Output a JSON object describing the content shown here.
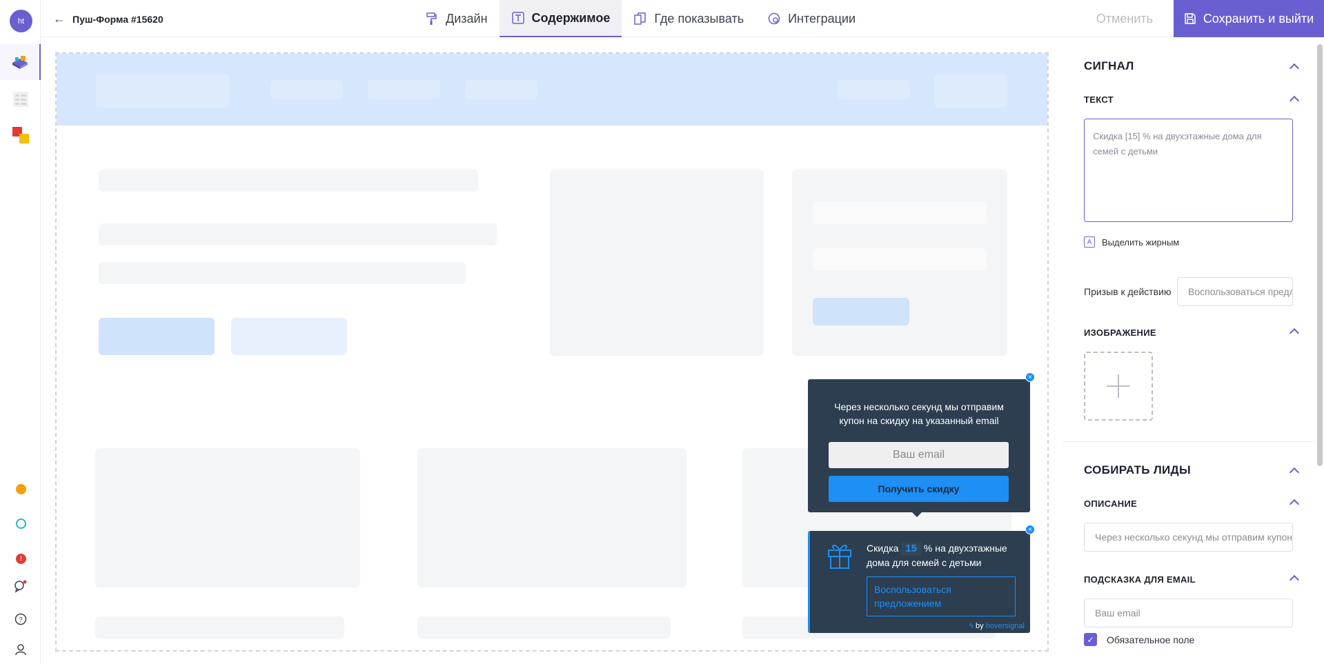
{
  "user": {
    "avatar_initials": "ht"
  },
  "header": {
    "back_arrow": "←",
    "title": "Пуш-Форма #15620",
    "tabs": [
      {
        "label": "Дизайн",
        "icon": "paint-roller-icon"
      },
      {
        "label": "Содержимое",
        "icon": "text-icon"
      },
      {
        "label": "Где показывать",
        "icon": "pages-icon"
      },
      {
        "label": "Интеграции",
        "icon": "integration-icon"
      }
    ],
    "active_tab": "Содержимое",
    "cancel_label": "Отменить",
    "save_label": "Сохранить и выйти"
  },
  "rail": {
    "icons": [
      "widgets-icon",
      "list-icon",
      "apps-icon"
    ],
    "status_dots": [
      {
        "color": "#f5a00d"
      },
      {
        "color": "#21b8c9"
      },
      {
        "color": "#e53935"
      }
    ],
    "bottom_icons": [
      "chat-icon",
      "help-icon",
      "profile-icon"
    ]
  },
  "preview": {
    "popup_form": {
      "message": "Через несколько секунд мы отправим купон на скидку на указанный email",
      "email_placeholder": "Ваш email",
      "button_label": "Получить скидку"
    },
    "signal": {
      "text_before": "Скидка",
      "number": "15",
      "text_after": "% на двухэтажные дома для семей с детьми",
      "cta_label": "Воспользоваться предложением",
      "by": "by",
      "brand": "hoversignal"
    },
    "close_glyph": "×"
  },
  "panel": {
    "signal_title": "СИГНАЛ",
    "text_section": "ТЕКСТ",
    "text_value": "Скидка [15] % на двухэтажные дома для семей с детьми",
    "bold_option": "Выделить жирным",
    "bold_icon_glyph": "A",
    "cta_label": "Призыв к действию",
    "cta_value": "Воспользоваться предложением",
    "image_section": "ИЗОБРАЖЕНИЕ",
    "leads_title": "СОБИРАТЬ ЛИДЫ",
    "description_section": "ОПИСАНИЕ",
    "description_value": "Через несколько секунд мы отправим купон на скидку на указанный email",
    "email_hint_section": "ПОДСКАЗКА ДЛЯ EMAIL",
    "email_hint_value": "Ваш email",
    "required_label": "Обязательное поле",
    "required_checked": true,
    "check_glyph": "✓"
  },
  "colors": {
    "accent": "#6a5fd0",
    "popup_bg": "#2c3e50",
    "popup_blue": "#1e8ff5"
  }
}
